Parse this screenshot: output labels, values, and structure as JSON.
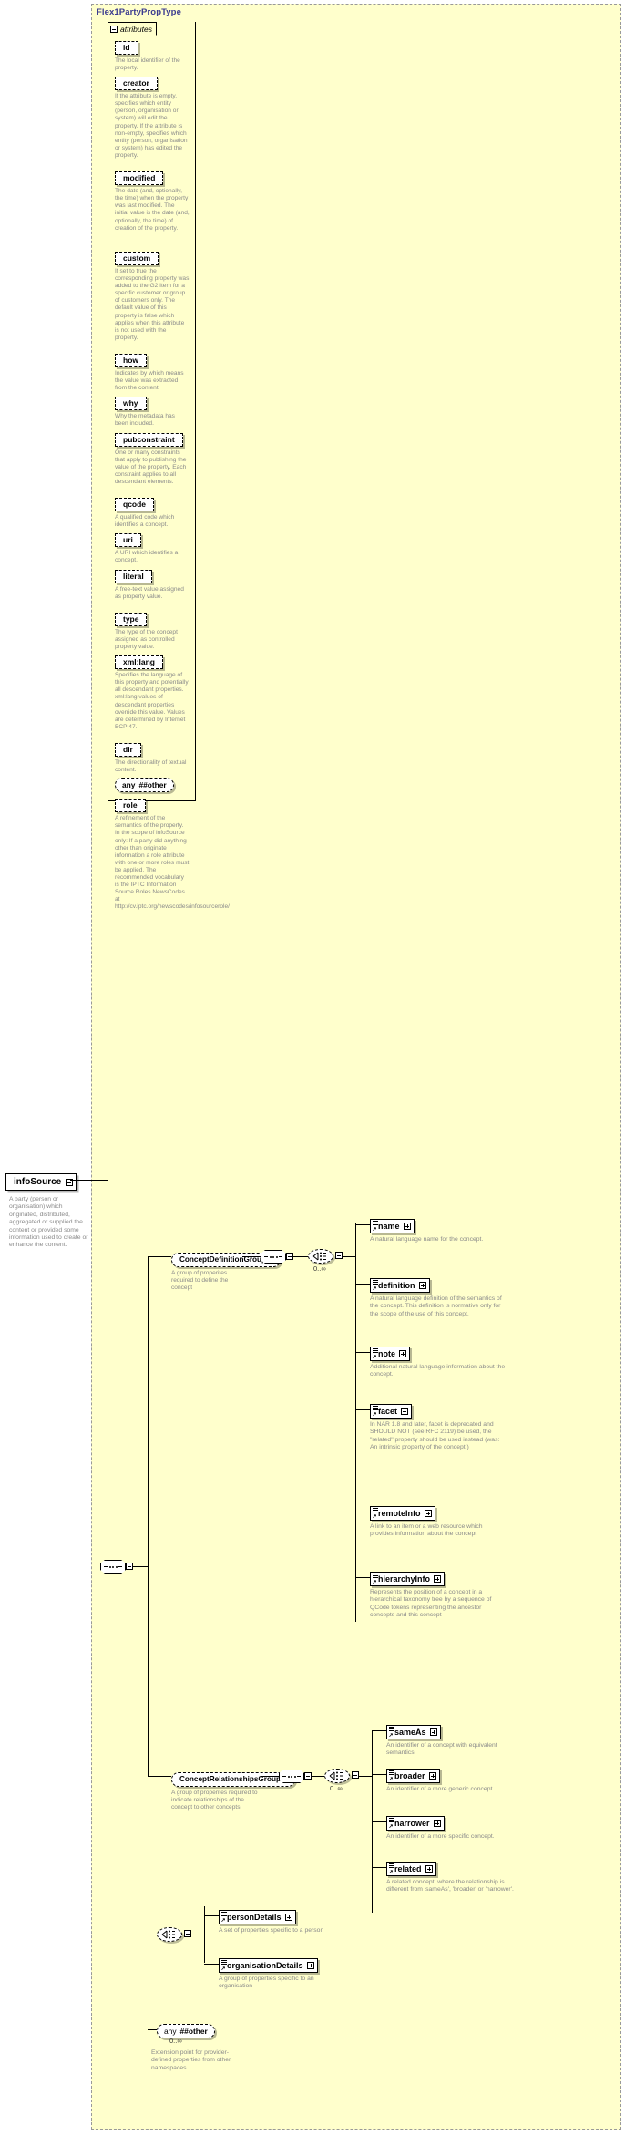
{
  "diagram": {
    "type": "xsd-schema-diagram",
    "title": "Flex1PartyPropType",
    "root_element": {
      "name": "infoSource",
      "toggle": "minus",
      "description": "A party (person or organisation) which originated, distributed, aggregated or supplied the content or provided some information used to create or enhance the content."
    },
    "attributes_section": {
      "label": "attributes",
      "toggle": "minus",
      "items": [
        {
          "name": "id",
          "description": "The local identifier of the property."
        },
        {
          "name": "creator",
          "description": "If the attribute is empty, specifies which entity (person, organisation or system) will edit the property. If the attribute is non-empty, specifies which entity (person, organisation or system) has edited the property."
        },
        {
          "name": "modified",
          "description": "The date (and, optionally, the time) when the property was last modified. The initial value is the date (and, optionally, the time) of creation of the property."
        },
        {
          "name": "custom",
          "description": "If set to true the corresponding property was added to the G2 Item for a specific customer or group of customers only. The default value of this property is false which applies when this attribute is not used with the property."
        },
        {
          "name": "how",
          "description": "Indicates by which means the value was extracted from the content."
        },
        {
          "name": "why",
          "description": "Why the metadata has been included."
        },
        {
          "name": "pubconstraint",
          "description": "One or many constraints that apply to publishing the value of the property. Each constraint applies to all descendant elements."
        },
        {
          "name": "qcode",
          "description": "A qualified code which identifies a concept."
        },
        {
          "name": "uri",
          "description": "A URI which identifies a concept."
        },
        {
          "name": "literal",
          "description": "A free-text value assigned as property value."
        },
        {
          "name": "type",
          "description": "The type of the concept assigned as controlled property value."
        },
        {
          "name": "xml:lang",
          "description": "Specifies the language of this property and potentially all descendant properties. xml:lang values of descendant properties override this value. Values are determined by Internet BCP 47."
        },
        {
          "name": "dir",
          "description": "The directionality of textual content."
        },
        {
          "name": "any ##other",
          "is_any": true,
          "description": ""
        },
        {
          "name": "role",
          "description": "A refinement of the semantics of the property. In the scope of infoSource only: If a party did anything other than originate information a role attribute with one or more roles must be applied. The recommended vocabulary is the IPTC Information Source Roles NewsCodes at http://cv.iptc.org/newscodes/infosourcerole/"
        }
      ]
    },
    "groups": [
      {
        "name": "ConceptDefinitionGroup",
        "toggle": "minus",
        "description": "A group of properites required to define the concept",
        "multiplicity": "0..∞",
        "elements": [
          {
            "name": "name",
            "toggle": "plus",
            "description": "A natural language name for the concept."
          },
          {
            "name": "definition",
            "toggle": "plus",
            "description": "A natural language definition of the semantics of the concept. This definition is normative only for the scope of the use of this concept."
          },
          {
            "name": "note",
            "toggle": "plus",
            "description": "Additional natural language information about the concept."
          },
          {
            "name": "facet",
            "toggle": "plus",
            "description": "In NAR 1.8 and later, facet is deprecated and SHOULD NOT (see RFC 2119) be used, the \"related\" property should be used instead (was: An intrinsic property of the concept.)"
          },
          {
            "name": "remoteInfo",
            "toggle": "plus",
            "description": "A link to an item or a web resource which provides information about the concept"
          },
          {
            "name": "hierarchyInfo",
            "toggle": "plus",
            "description": "Represents the position of a concept in a hierarchical taxonomy tree by a sequence of QCode tokens representing the ancestor concepts and this concept"
          }
        ]
      },
      {
        "name": "ConceptRelationshipsGroup",
        "toggle": "minus",
        "description": "A group of properites required to indicate relationships of the concept to other concepts",
        "multiplicity": "0..∞",
        "elements": [
          {
            "name": "sameAs",
            "toggle": "plus",
            "description": "An identifier of a concept with equivalent semantics"
          },
          {
            "name": "broader",
            "toggle": "plus",
            "description": "An identifier of a more generic concept."
          },
          {
            "name": "narrower",
            "toggle": "plus",
            "description": "An identifier of a more specific concept."
          },
          {
            "name": "related",
            "toggle": "plus",
            "description": "A related concept, where the relationship is different from 'sameAs', 'broader' or 'narrower'."
          }
        ]
      }
    ],
    "detail_choice": {
      "toggle": "minus",
      "elements": [
        {
          "name": "personDetails",
          "toggle": "plus",
          "description": "A set of properties specific to a person"
        },
        {
          "name": "organisationDetails",
          "toggle": "plus",
          "description": "A group of properties specific to an organisation"
        }
      ]
    },
    "extension_any": {
      "label": "any",
      "namespace": "##other",
      "multiplicity": "0..∞",
      "description": "Extension point for provider-defined properties from other namespaces"
    },
    "colors": {
      "panel_bg": "#ffffcc",
      "panel_border": "#999999",
      "title_color": "#3b3b8f",
      "desc_color": "#8a8a8a",
      "line_color": "#000000"
    }
  }
}
